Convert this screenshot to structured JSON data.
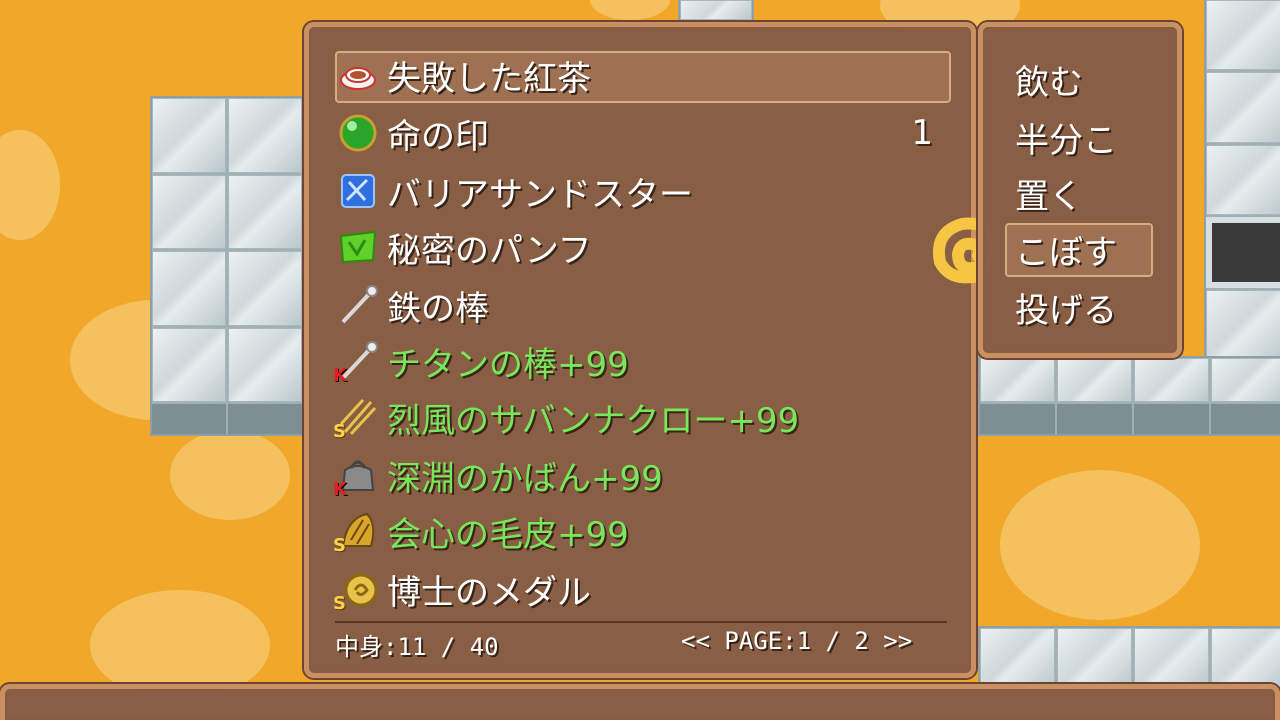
{
  "item_window": {
    "items": [
      {
        "name": "失敗した紅茶",
        "count": "",
        "icon": "teacup-icon",
        "badge": "",
        "color": "white"
      },
      {
        "name": "命の印",
        "count": "1",
        "icon": "green-orb-icon",
        "badge": "",
        "color": "white"
      },
      {
        "name": "バリアサンドスター",
        "count": "",
        "icon": "blue-crystal-icon",
        "badge": "",
        "color": "white"
      },
      {
        "name": "秘密のパンフ",
        "count": "",
        "icon": "green-pamphlet-icon",
        "badge": "",
        "color": "white"
      },
      {
        "name": "鉄の棒",
        "count": "",
        "icon": "iron-rod-icon",
        "badge": "",
        "color": "white"
      },
      {
        "name": "チタンの棒+99",
        "count": "",
        "icon": "titanium-rod-icon",
        "badge": "K",
        "color": "green"
      },
      {
        "name": "烈風のサバンナクロー+99",
        "count": "",
        "icon": "claw-icon",
        "badge": "S",
        "color": "green"
      },
      {
        "name": "深淵のかばん+99",
        "count": "",
        "icon": "bag-icon",
        "badge": "K",
        "color": "green"
      },
      {
        "name": "会心の毛皮+99",
        "count": "",
        "icon": "fur-icon",
        "badge": "S",
        "color": "green"
      },
      {
        "name": "博士のメダル",
        "count": "",
        "icon": "medal-icon",
        "badge": "S",
        "color": "white"
      }
    ],
    "contents_label": "中身:11 / 40",
    "page_label": "<< PAGE:1 / 2 >>"
  },
  "command_window": {
    "commands": [
      "飲む",
      "半分こ",
      "置く",
      "こぼす",
      "投げる"
    ],
    "selected_index": 3,
    "cursor_icon": "swirl-cursor-icon"
  },
  "colors": {
    "background": "#f0a72a",
    "window_fill": "#805846",
    "window_border": "#c89063",
    "text": "#ffffff",
    "enhanced_text": "#78e85a"
  }
}
